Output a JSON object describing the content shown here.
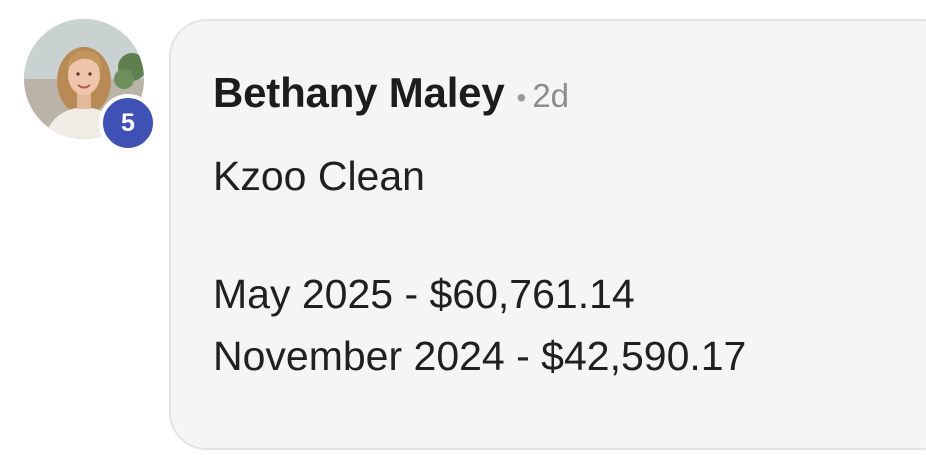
{
  "comment": {
    "author": "Bethany Maley",
    "separator": "•",
    "time": "2d",
    "badge_count": "5",
    "lines": [
      "Kzoo Clean",
      "May 2025 - $60,761.14",
      "November 2024 - $42,590.17"
    ]
  },
  "colors": {
    "badge": "#3f51b5",
    "bubble_bg": "#f6f5f3",
    "bubble_border": "#e4e3e1"
  }
}
